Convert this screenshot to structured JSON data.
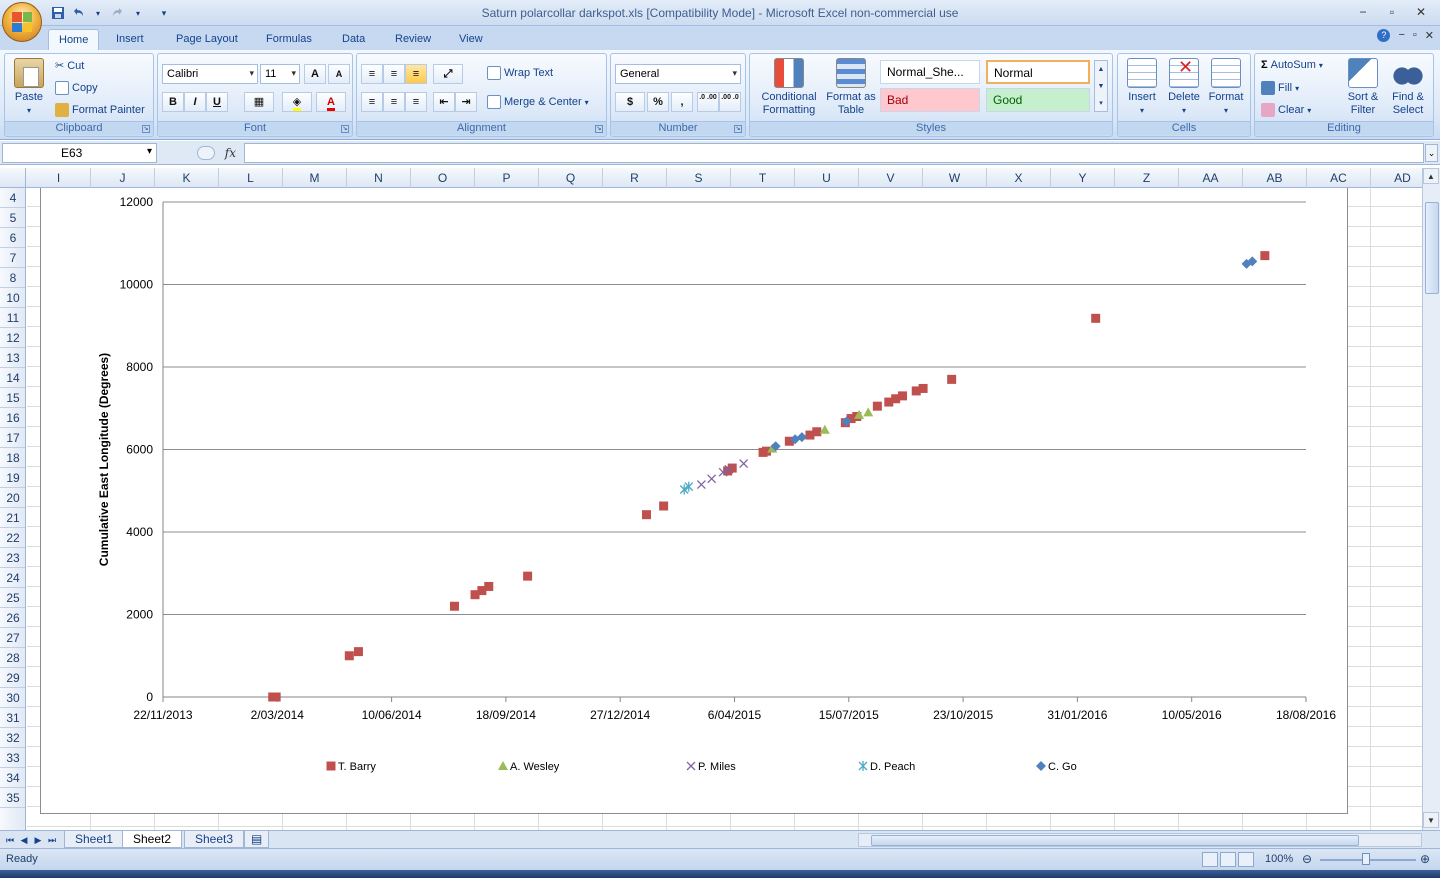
{
  "window": {
    "title": "Saturn polarcollar darkspot.xls  [Compatibility Mode] - Microsoft Excel non-commercial use",
    "minimize": "−",
    "restore": "▫",
    "close": "✕"
  },
  "quick_access": {
    "save_icon": "save-icon",
    "undo_icon": "undo-icon",
    "redo_icon": "redo-icon",
    "customize": "▾"
  },
  "tabs": [
    {
      "label": "Home",
      "active": true
    },
    {
      "label": "Insert"
    },
    {
      "label": "Page Layout"
    },
    {
      "label": "Formulas"
    },
    {
      "label": "Data"
    },
    {
      "label": "Review"
    },
    {
      "label": "View"
    }
  ],
  "ribbon": {
    "clipboard": {
      "label": "Clipboard",
      "paste": "Paste",
      "cut": "Cut",
      "copy": "Copy",
      "format_painter": "Format Painter"
    },
    "font": {
      "label": "Font",
      "family": "Calibri",
      "size": "11",
      "bold": "B",
      "italic": "I",
      "underline": "U",
      "grow": "A",
      "shrink": "A"
    },
    "alignment": {
      "label": "Alignment",
      "wrap_text": "Wrap Text",
      "merge_center": "Merge & Center"
    },
    "number": {
      "label": "Number",
      "format": "General",
      "currency": "$",
      "percent": "%",
      "comma": ",",
      "inc_decimal": ".0 .00",
      "dec_decimal": ".00 .0"
    },
    "styles": {
      "label": "Styles",
      "conditional": "Conditional Formatting",
      "format_table": "Format as Table",
      "normal_sheet": "Normal_She...",
      "normal": "Normal",
      "bad": "Bad",
      "good": "Good"
    },
    "cells": {
      "label": "Cells",
      "insert": "Insert",
      "delete": "Delete",
      "format": "Format"
    },
    "editing": {
      "label": "Editing",
      "autosum": "AutoSum",
      "fill": "Fill",
      "clear": "Clear",
      "sort_filter": "Sort & Filter",
      "find_select": "Find & Select"
    }
  },
  "formula_bar": {
    "name_box": "E63",
    "fx": "fx",
    "formula": ""
  },
  "columns": [
    "I",
    "J",
    "K",
    "L",
    "M",
    "N",
    "O",
    "P",
    "Q",
    "R",
    "S",
    "T",
    "U",
    "V",
    "W",
    "X",
    "Y",
    "Z",
    "AA",
    "AB",
    "AC",
    "AD"
  ],
  "rows": [
    "4",
    "5",
    "6",
    "7",
    "8",
    "10",
    "11",
    "12",
    "13",
    "14",
    "15",
    "16",
    "17",
    "18",
    "19",
    "20",
    "21",
    "22",
    "23",
    "24",
    "25",
    "26",
    "27",
    "28",
    "29",
    "30",
    "31",
    "32",
    "33",
    "34",
    "35"
  ],
  "sheets": [
    {
      "label": "Sheet1"
    },
    {
      "label": "Sheet2",
      "active": true
    },
    {
      "label": "Sheet3"
    }
  ],
  "status": {
    "ready": "Ready",
    "zoom": "100%"
  },
  "chart_data": {
    "type": "scatter",
    "title": "",
    "xlabel": "",
    "ylabel": "Cumulative East Longitude (Degrees)",
    "x_ticks": [
      "22/11/2013",
      "2/03/2014",
      "10/06/2014",
      "18/09/2014",
      "27/12/2014",
      "6/04/2015",
      "15/07/2015",
      "23/10/2015",
      "31/01/2016",
      "10/05/2016",
      "18/08/2016"
    ],
    "xlim": [
      "2013-11-22",
      "2016-08-18"
    ],
    "ylim": [
      0,
      12000
    ],
    "y_ticks": [
      0,
      2000,
      4000,
      6000,
      8000,
      10000,
      12000
    ],
    "grid": "horizontal",
    "legend": "bottom",
    "series": [
      {
        "name": "T. Barry",
        "marker": "square",
        "color": "#c0504d",
        "points": [
          [
            "2014-02-26",
            0
          ],
          [
            "2014-03-01",
            0
          ],
          [
            "2014-05-04",
            1000
          ],
          [
            "2014-05-12",
            1100
          ],
          [
            "2014-08-04",
            2200
          ],
          [
            "2014-08-22",
            2480
          ],
          [
            "2014-08-28",
            2580
          ],
          [
            "2014-09-03",
            2680
          ],
          [
            "2014-10-07",
            2930
          ],
          [
            "2015-01-19",
            4420
          ],
          [
            "2015-02-03",
            4630
          ],
          [
            "2015-03-31",
            5480
          ],
          [
            "2015-04-04",
            5550
          ],
          [
            "2015-05-01",
            5930
          ],
          [
            "2015-05-04",
            5960
          ],
          [
            "2015-05-24",
            6200
          ],
          [
            "2015-06-11",
            6350
          ],
          [
            "2015-06-17",
            6430
          ],
          [
            "2015-07-12",
            6650
          ],
          [
            "2015-07-17",
            6750
          ],
          [
            "2015-07-22",
            6800
          ],
          [
            "2015-08-09",
            7050
          ],
          [
            "2015-08-19",
            7150
          ],
          [
            "2015-08-25",
            7230
          ],
          [
            "2015-08-31",
            7300
          ],
          [
            "2015-09-12",
            7420
          ],
          [
            "2015-09-18",
            7480
          ],
          [
            "2015-10-13",
            7700
          ],
          [
            "2016-02-16",
            9180
          ],
          [
            "2016-07-13",
            10700
          ]
        ]
      },
      {
        "name": "A. Wesley",
        "marker": "triangle",
        "color": "#9bbb59",
        "points": [
          [
            "2015-05-09",
            6020
          ],
          [
            "2015-06-24",
            6480
          ],
          [
            "2015-08-01",
            6900
          ],
          [
            "2015-07-24",
            6840
          ]
        ]
      },
      {
        "name": "P. Miles",
        "marker": "x",
        "color": "#8064a2",
        "points": [
          [
            "2015-03-08",
            5150
          ],
          [
            "2015-03-17",
            5290
          ],
          [
            "2015-03-27",
            5450
          ],
          [
            "2015-04-14",
            5660
          ],
          [
            "2015-04-01",
            5520
          ]
        ]
      },
      {
        "name": "D. Peach",
        "marker": "asterisk",
        "color": "#4bacc6",
        "points": [
          [
            "2015-02-21",
            5030
          ],
          [
            "2015-02-25",
            5100
          ]
        ]
      },
      {
        "name": "C. Go",
        "marker": "diamond",
        "color": "#4f81bd",
        "points": [
          [
            "2015-05-12",
            6080
          ],
          [
            "2015-05-29",
            6250
          ],
          [
            "2015-06-04",
            6300
          ],
          [
            "2015-07-13",
            6680
          ],
          [
            "2016-06-27",
            10500
          ],
          [
            "2016-07-02",
            10560
          ]
        ]
      }
    ]
  }
}
